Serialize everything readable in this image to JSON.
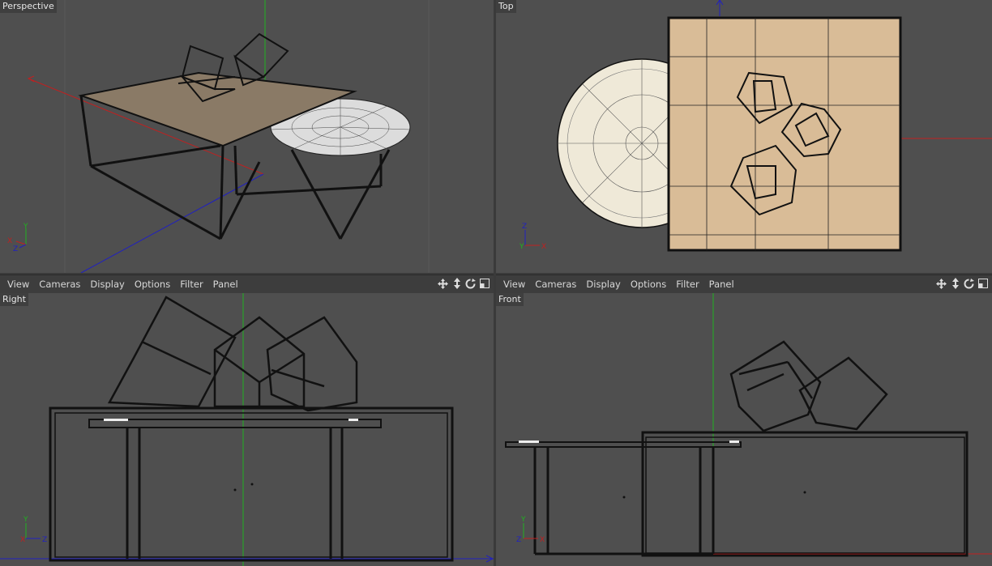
{
  "viewports": {
    "perspective": {
      "label": "Perspective"
    },
    "top": {
      "label": "Top"
    },
    "right": {
      "label": "Right"
    },
    "front": {
      "label": "Front"
    }
  },
  "menu": [
    "View",
    "Cameras",
    "Display",
    "Options",
    "Filter",
    "Panel"
  ],
  "axis_labels": {
    "x": "X",
    "y": "Y",
    "z": "Z"
  },
  "nav_icons": [
    "move-view-icon",
    "zoom-view-icon",
    "rotate-view-icon",
    "toggle-panel-icon"
  ],
  "colors": {
    "viewport_bg": "#4f4f4f",
    "toolbar_bg": "#3d3d3d",
    "axis_x": "#c02020",
    "axis_y": "#20b020",
    "axis_z": "#2020c0",
    "wood": "#d9bc97",
    "marble": "#efe9d8"
  }
}
